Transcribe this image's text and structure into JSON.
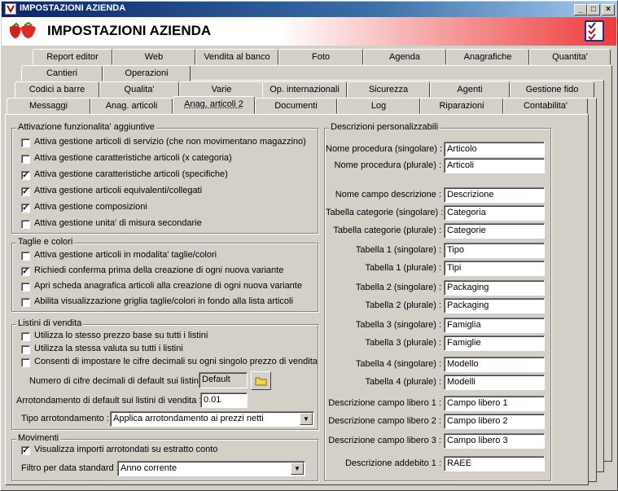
{
  "window": {
    "title": "IMPOSTAZIONI AZIENDA",
    "header_title": "IMPOSTAZIONI AZIENDA"
  },
  "tabs_row1": [
    "Report editor",
    "Web",
    "Vendita al banco",
    "Foto",
    "Agenda",
    "Anagrafiche",
    "Quantita'"
  ],
  "tabs_row2": [
    "Cantieri",
    "Operazioni"
  ],
  "tabs_row3": [
    "Codici a barre",
    "Qualita'",
    "Varie",
    "Op. internazionali",
    "Sicurezza",
    "Agenti",
    "Gestione fido"
  ],
  "tabs_row4": [
    "Messaggi",
    "Anag. articoli",
    "Anag. articoli 2",
    "Documenti",
    "Log",
    "Riparazioni",
    "Contabilita'"
  ],
  "active_tab": "Anag. articoli 2",
  "attivazione": {
    "title": "Attivazione funzionalita' aggiuntive",
    "items": [
      {
        "label": "Attiva gestione articoli di servizio (che non movimentano magazzino)",
        "checked": false
      },
      {
        "label": "Attiva gestione caratteristiche articoli (x categoria)",
        "checked": false
      },
      {
        "label": "Attiva gestione caratteristiche articoli (specifiche)",
        "checked": true
      },
      {
        "label": "Attiva gestione articoli equivalenti/collegati",
        "checked": true
      },
      {
        "label": "Attiva gestione composizioni",
        "checked": true
      },
      {
        "label": "Attiva gestione unita' di misura secondarie",
        "checked": false
      }
    ]
  },
  "taglie": {
    "title": "Taglie e colori",
    "items": [
      {
        "label": "Attiva gestione articoli in modalita' taglie/colori",
        "checked": false
      },
      {
        "label": "Richiedi conferma prima della creazione di ogni nuova variante",
        "checked": true
      },
      {
        "label": "Apri scheda anagrafica articoli alla creazione di ogni nuova variante",
        "checked": false
      },
      {
        "label": "Abilita visualizzazione griglia taglie/colori in fondo alla lista articoli",
        "checked": false
      }
    ]
  },
  "listini": {
    "title": "Listini di vendita",
    "items": [
      {
        "label": "Utilizza lo stesso prezzo base su tutti i listini",
        "checked": false
      },
      {
        "label": "Utilizza la stessa valuta su tutti i listini",
        "checked": false
      },
      {
        "label": "Consenti di impostare le cifre decimali su ogni singolo prezzo di vendita",
        "checked": false
      }
    ],
    "decimali_label": "Numero di cifre decimali di default sui listini :",
    "decimali_value": "Default",
    "arrot_label": "Arrotondamento di default sui listini di vendita :",
    "arrot_value": "0.01",
    "tipo_label": "Tipo arrotondamento :",
    "tipo_value": "Applica arrotondamento ai prezzi netti"
  },
  "movimenti": {
    "title": "Movimenti",
    "item": {
      "label": "Visualizza importi arrotondati su estratto conto",
      "checked": true
    },
    "filtro_label": "Filtro per data standard :",
    "filtro_value": "Anno corrente"
  },
  "descrizioni": {
    "title": "Descrizioni personalizzabili",
    "rows": [
      {
        "label": "Nome procedura (singolare) :",
        "value": "Articolo"
      },
      {
        "label": "Nome procedura (plurale) :",
        "value": "Articoli"
      },
      {
        "label": "Nome campo descrizione :",
        "value": "Descrizione"
      },
      {
        "label": "Tabella categorie (singolare) :",
        "value": "Categoria"
      },
      {
        "label": "Tabella categorie (plurale) :",
        "value": "Categorie"
      },
      {
        "label": "Tabella 1 (singolare) :",
        "value": "Tipo"
      },
      {
        "label": "Tabella 1 (plurale) :",
        "value": "Tipi"
      },
      {
        "label": "Tabella 2 (singolare) :",
        "value": "Packaging"
      },
      {
        "label": "Tabella 2 (plurale) :",
        "value": "Packaging"
      },
      {
        "label": "Tabella 3 (singolare) :",
        "value": "Famiglia"
      },
      {
        "label": "Tabella 3 (plurale) :",
        "value": "Famiglie"
      },
      {
        "label": "Tabella 4 (singolare) :",
        "value": "Modello"
      },
      {
        "label": "Tabella 4 (plurale) :",
        "value": "Modelli"
      },
      {
        "label": "Descrizione campo libero 1 :",
        "value": "Campo libero 1"
      },
      {
        "label": "Descrizione campo libero 2 :",
        "value": "Campo libero 2"
      },
      {
        "label": "Descrizione campo libero 3 :",
        "value": "Campo libero 3"
      },
      {
        "label": "Descrizione addebito 1 :",
        "value": "RAEE"
      }
    ]
  }
}
